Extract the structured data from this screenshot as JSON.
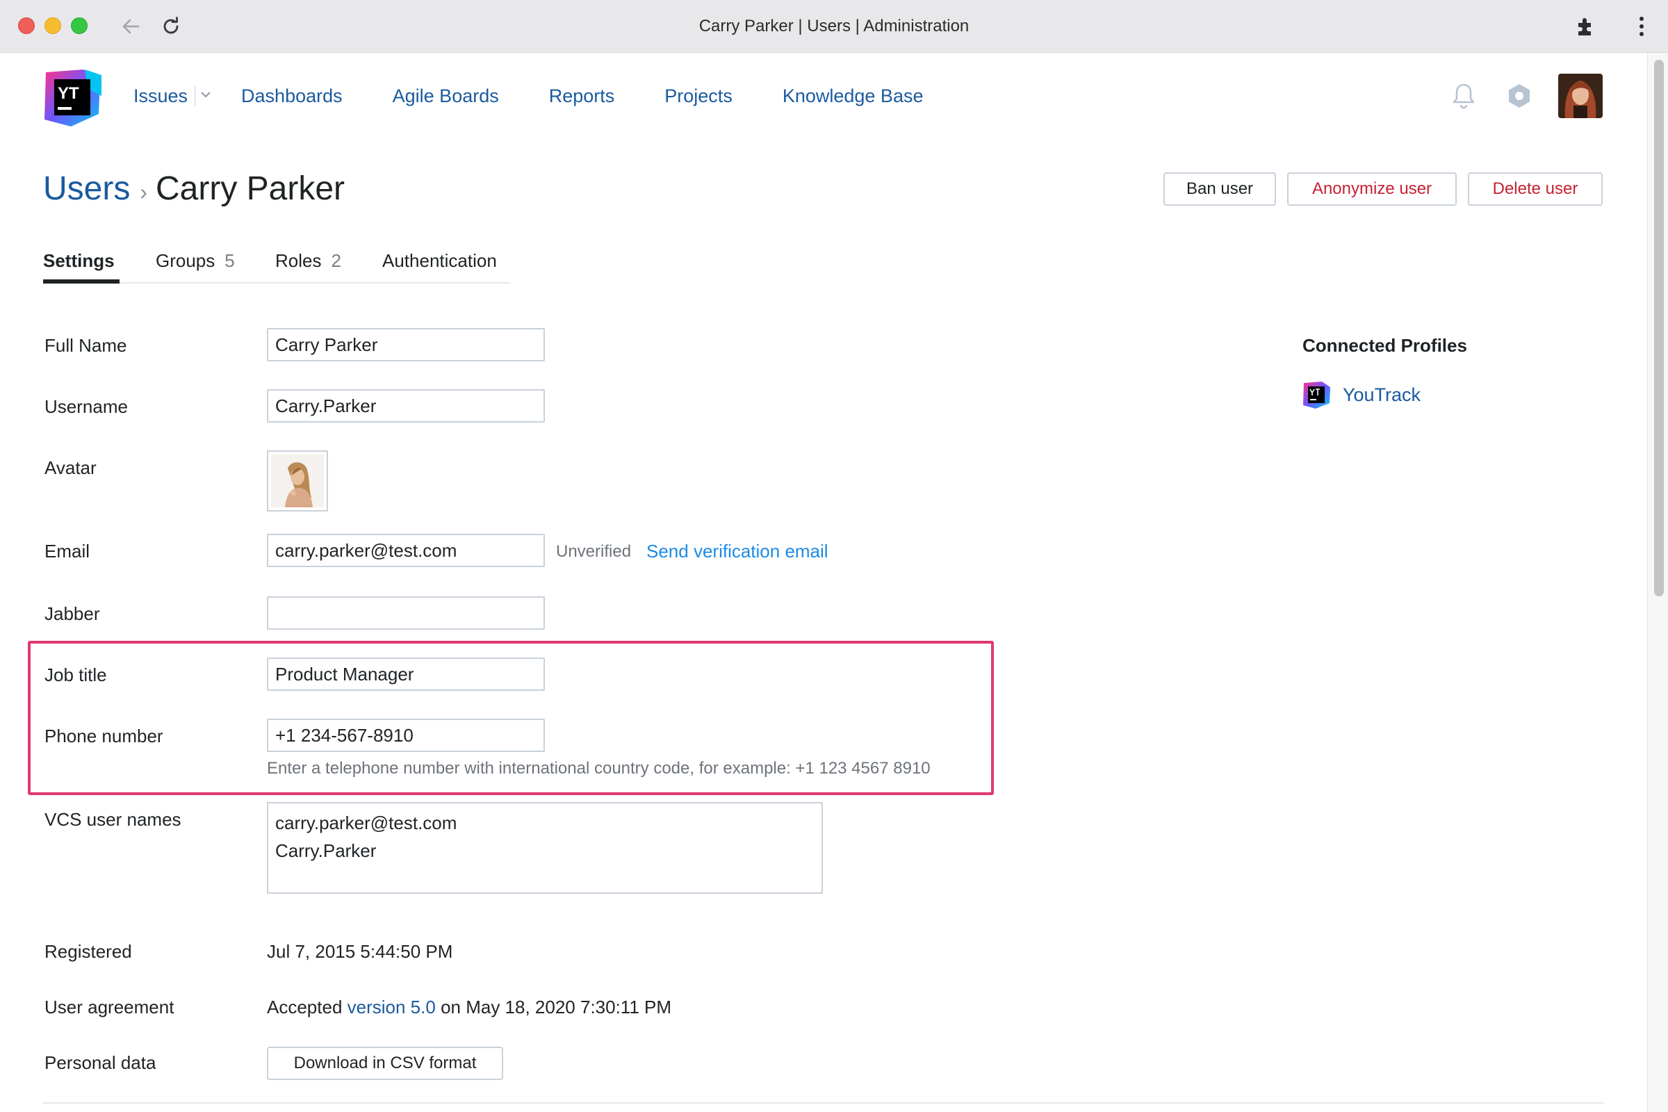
{
  "browser": {
    "title": "Carry Parker | Users | Administration"
  },
  "nav": {
    "logo_text": "YT",
    "items": [
      "Issues",
      "Dashboards",
      "Agile Boards",
      "Reports",
      "Projects",
      "Knowledge Base"
    ]
  },
  "header_icons": [
    "bell-icon",
    "settings-icon",
    "user-avatar"
  ],
  "breadcrumb": {
    "parent": "Users",
    "separator": "›",
    "current": "Carry Parker"
  },
  "actions": {
    "ban": "Ban user",
    "anonymize": "Anonymize user",
    "delete": "Delete user"
  },
  "tabs": {
    "settings": {
      "label": "Settings"
    },
    "groups": {
      "label": "Groups",
      "count": "5"
    },
    "roles": {
      "label": "Roles",
      "count": "2"
    },
    "authentication": {
      "label": "Authentication"
    },
    "active": "Settings"
  },
  "form": {
    "full_name": {
      "label": "Full Name",
      "value": "Carry Parker"
    },
    "username": {
      "label": "Username",
      "value": "Carry.Parker"
    },
    "avatar": {
      "label": "Avatar"
    },
    "email": {
      "label": "Email",
      "value": "carry.parker@test.com",
      "status": "Unverified",
      "action": "Send verification email"
    },
    "jabber": {
      "label": "Jabber",
      "value": ""
    },
    "job_title": {
      "label": "Job title",
      "value": "Product Manager"
    },
    "phone": {
      "label": "Phone number",
      "value": "+1 234-567-8910",
      "hint": "Enter a telephone number with international country code, for example: +1 123 4567 8910"
    },
    "vcs": {
      "label": "VCS user names",
      "lines": [
        "carry.parker@test.com",
        "Carry.Parker"
      ]
    },
    "registered": {
      "label": "Registered",
      "value": "Jul 7, 2015 5:44:50 PM"
    },
    "agreement": {
      "label": "User agreement",
      "prefix": "Accepted",
      "version": "version 5.0",
      "suffix": "on May 18, 2020 7:30:11 PM"
    },
    "personal_data": {
      "label": "Personal data",
      "button": "Download in CSV format"
    }
  },
  "connected_profiles": {
    "title": "Connected Profiles",
    "items": [
      {
        "label": "YouTrack",
        "icon": "youtrack-logo-icon"
      }
    ]
  },
  "colors": {
    "link": "#1a5a9e",
    "accent_link": "#1c8ae6",
    "danger": "#c52233",
    "highlight_border": "#e0386f"
  }
}
